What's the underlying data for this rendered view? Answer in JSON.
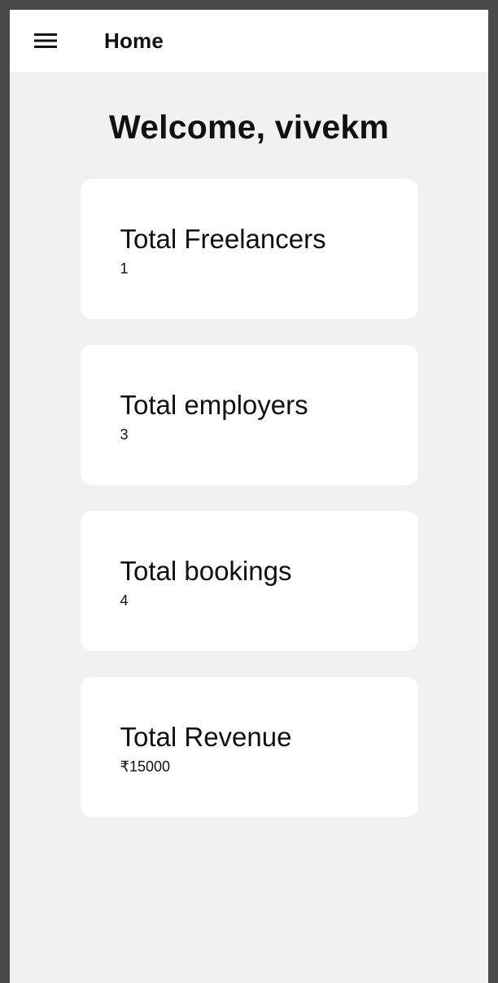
{
  "app_bar": {
    "menu_icon": "menu-icon",
    "title": "Home"
  },
  "main": {
    "welcome": "Welcome, vivekm",
    "cards": [
      {
        "title": "Total Freelancers",
        "value": "1"
      },
      {
        "title": "Total employers",
        "value": "3"
      },
      {
        "title": "Total bookings",
        "value": "4"
      },
      {
        "title": "Total Revenue",
        "value": "₹15000"
      }
    ]
  },
  "colors": {
    "app_bar_background": "#ffffff",
    "page_background": "#f1f1f1",
    "card_background": "#ffffff",
    "text": "#111111"
  }
}
